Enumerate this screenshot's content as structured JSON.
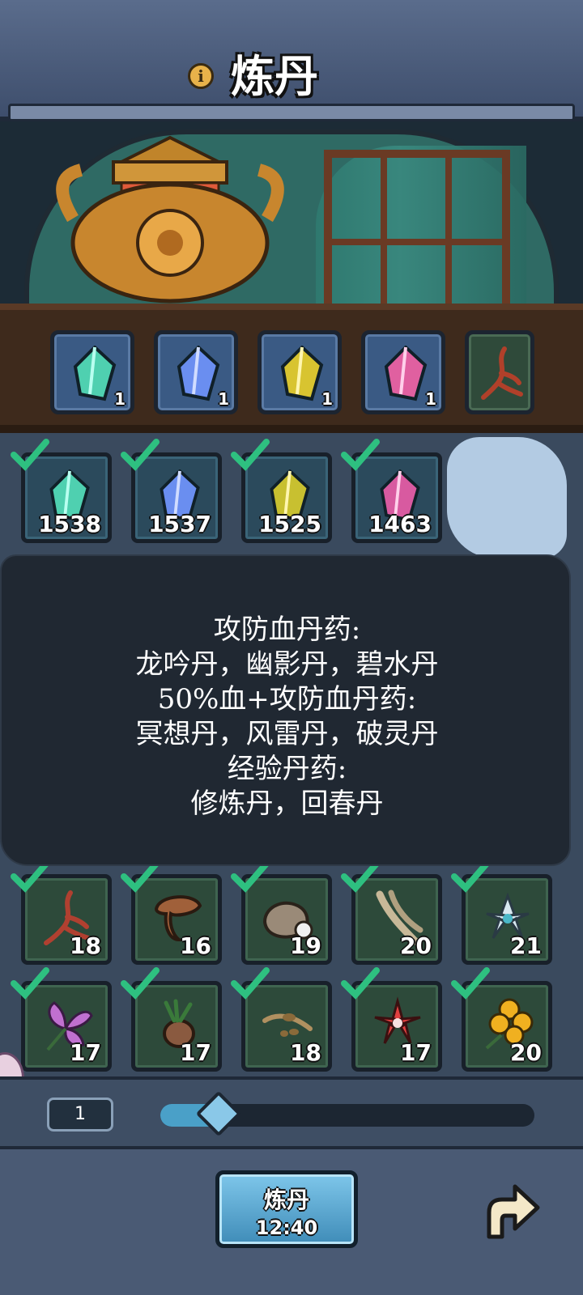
{
  "header": {
    "title": "炼丹",
    "info_icon": "info-icon"
  },
  "recipe_slots": [
    {
      "icon": "gem-teal-icon",
      "color": "#4fd0b0",
      "count": "1"
    },
    {
      "icon": "gem-blue-icon",
      "color": "#6a8ef0",
      "count": "1"
    },
    {
      "icon": "gem-yellow-icon",
      "color": "#d8c430",
      "count": "1"
    },
    {
      "icon": "gem-pink-icon",
      "color": "#e060a0",
      "count": "1"
    },
    {
      "icon": "ginseng-root-icon",
      "color": "#b0402a",
      "count": ""
    }
  ],
  "gem_inventory": [
    {
      "icon": "gem-teal-icon",
      "color": "#4fd0b0",
      "count": "1538",
      "checked": true
    },
    {
      "icon": "gem-blue-icon",
      "color": "#6a8ef0",
      "count": "1537",
      "checked": true
    },
    {
      "icon": "gem-yellow-icon",
      "color": "#c8c030",
      "count": "1525",
      "checked": true
    },
    {
      "icon": "gem-pink-icon",
      "color": "#d85aa0",
      "count": "1463",
      "checked": true
    }
  ],
  "tooltip": {
    "lines": [
      "攻防血丹药:",
      "龙吟丹，幽影丹，碧水丹",
      "50%血+攻防血丹药:",
      "冥想丹，风雷丹，破灵丹",
      "经验丹药:",
      "修炼丹，回春丹"
    ]
  },
  "herb_inventory": [
    {
      "icon": "ginseng-root-icon",
      "color": "#b04030",
      "count": "18"
    },
    {
      "icon": "lingzhi-mushroom-icon",
      "color": "#a0603a",
      "count": "16"
    },
    {
      "icon": "stone-ore-icon",
      "color": "#9a8a78",
      "count": "19"
    },
    {
      "icon": "bone-icon",
      "color": "#c8b898",
      "count": "20"
    },
    {
      "icon": "white-lotus-icon",
      "color": "#d8e8f0",
      "count": "21"
    },
    {
      "icon": "purple-flower-icon",
      "color": "#c070d0",
      "count": "17"
    },
    {
      "icon": "tuber-root-icon",
      "color": "#8a5a40",
      "count": "17"
    },
    {
      "icon": "seed-sprout-icon",
      "color": "#b09060",
      "count": "18"
    },
    {
      "icon": "red-flower-icon",
      "color": "#e04040",
      "count": "17"
    },
    {
      "icon": "yellow-flower-icon",
      "color": "#f0b020",
      "count": "20"
    }
  ],
  "quantity": {
    "value": "1",
    "slider_fraction": 0.1
  },
  "action": {
    "label": "炼丹",
    "time": "12:40"
  },
  "colors": {
    "check": "#2ec080",
    "accent": "#7ec6ea"
  }
}
